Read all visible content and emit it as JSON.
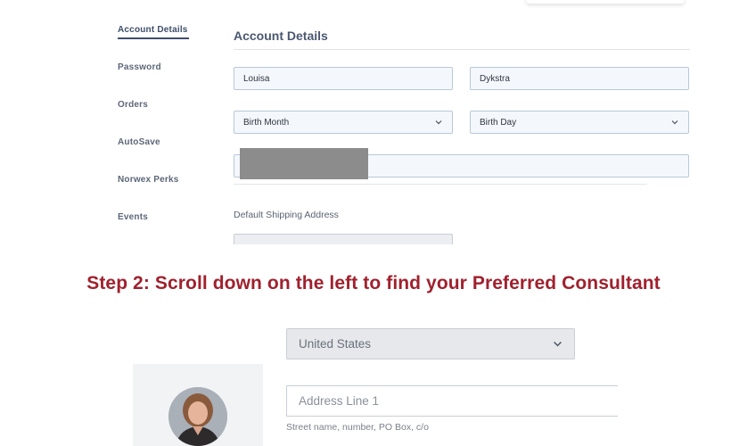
{
  "sidebar": {
    "items": [
      {
        "label": "Account Details"
      },
      {
        "label": "Password"
      },
      {
        "label": "Orders"
      },
      {
        "label": "AutoSave"
      },
      {
        "label": "Norwex Perks"
      },
      {
        "label": "Events"
      }
    ]
  },
  "account": {
    "title": "Account Details",
    "first_name": "Louisa",
    "last_name": "Dykstra",
    "birth_month": "Birth Month",
    "birth_day": "Birth Day",
    "default_shipping_label": "Default Shipping Address"
  },
  "step": {
    "heading": "Step 2: Scroll down on the left to find your Preferred Consultant"
  },
  "address": {
    "country": "United States",
    "line1_placeholder": "Address Line 1",
    "line1_hint": "Street name, number, PO Box, c/o"
  },
  "colors": {
    "accent": "#3f4f6a",
    "heading_red": "#a0212e",
    "field_bg": "#f4f8fc",
    "redaction": "#8c8c8c"
  },
  "icons": {
    "dropdown": "chevron-down-icon"
  }
}
